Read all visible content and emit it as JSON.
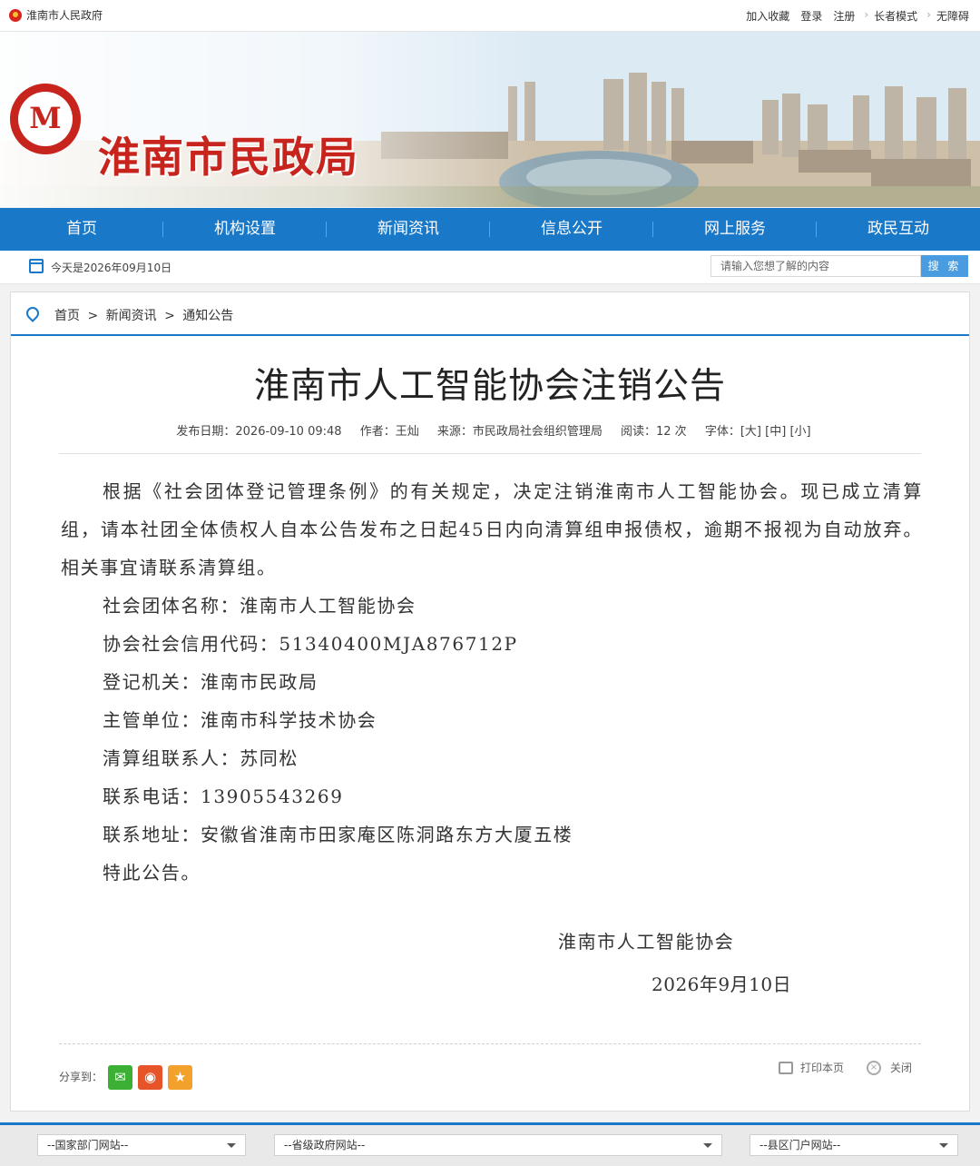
{
  "topbar": {
    "site_name": "淮南市人民政府",
    "links": [
      "加入收藏",
      "登录",
      "注册",
      "长者模式",
      "无障碍"
    ]
  },
  "banner": {
    "title": "淮南市民政局",
    "logo_letter": "M"
  },
  "nav": [
    "首页",
    "机构设置",
    "新闻资讯",
    "信息公开",
    "网上服务",
    "政民互动"
  ],
  "datebar": {
    "today": "今天是2026年09月10日",
    "search_placeholder": "请输入您想了解的内容",
    "search_button": "搜 索"
  },
  "breadcrumb": [
    "首页",
    ">",
    "新闻资讯",
    ">",
    "通知公告"
  ],
  "article": {
    "title": "淮南市人工智能协会注销公告",
    "meta": {
      "date": "发布日期：2026-09-10 09:48",
      "author": "作者：王灿",
      "source": "来源：市民政局社会组织管理局",
      "reads": "阅读：12 次",
      "font_label": "字体：",
      "font_large": "[大]",
      "font_medium": "[中]",
      "font_small": "[小]"
    },
    "paragraph": "根据《社会团体登记管理条例》的有关规定，决定注销淮南市人工智能协会。现已成立清算组，请本社团全体债权人自本公告发布之日起45日内向清算组申报债权，逾期不报视为自动放弃。相关事宜请联系清算组。",
    "lines": [
      "社会团体名称：淮南市人工智能协会",
      "协会社会信用代码：51340400MJA876712P",
      "登记机关：淮南市民政局",
      "主管单位：淮南市科学技术协会",
      "清算组联系人：苏同松",
      "联系电话：13905543269",
      "联系地址：安徽省淮南市田家庵区陈洞路东方大厦五楼",
      "特此公告。"
    ],
    "signature": "淮南市人工智能协会",
    "sign_date": "2026年9月10日"
  },
  "share": {
    "label": "分享到：",
    "icons": [
      "wechat-icon",
      "weibo-icon",
      "favorite-icon"
    ]
  },
  "actions": {
    "print": "打印本页",
    "close": "关闭"
  },
  "footer": {
    "selects": [
      "--国家部门网站--",
      "--省级政府网站--",
      "--县区门户网站--"
    ]
  },
  "colors": {
    "nav_blue": "#1a78c8",
    "brand_red": "#c8241e",
    "search_button": "#4a9ce0"
  }
}
